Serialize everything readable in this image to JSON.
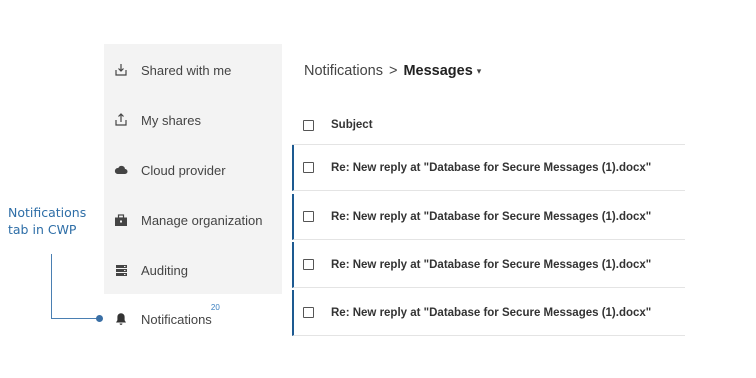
{
  "annotation": {
    "text": "Notifications tab in CWP"
  },
  "sidebar": {
    "items": [
      {
        "label": "Shared with me",
        "icon": "download-tray-icon"
      },
      {
        "label": "My shares",
        "icon": "upload-tray-icon"
      },
      {
        "label": "Cloud provider",
        "icon": "cloud-icon"
      },
      {
        "label": "Manage organization",
        "icon": "briefcase-icon"
      },
      {
        "label": "Auditing",
        "icon": "server-icon"
      },
      {
        "label": "Notifications",
        "icon": "bell-icon",
        "badge": "20"
      }
    ]
  },
  "breadcrumb": {
    "parent": "Notifications",
    "separator": ">",
    "current": "Messages",
    "caret": "▾"
  },
  "table": {
    "header": "Subject",
    "rows": [
      {
        "subject": "Re: New reply at \"Database for Secure Messages (1).docx\""
      },
      {
        "subject": "Re: New reply at \"Database for Secure Messages (1).docx\""
      },
      {
        "subject": "Re: New reply at \"Database for Secure Messages (1).docx\""
      },
      {
        "subject": "Re: New reply at \"Database for Secure Messages (1).docx\""
      }
    ]
  },
  "colors": {
    "accent": "#1d5a91",
    "annotation": "#2e6ea7",
    "sidebar_bg": "#f3f3f3"
  }
}
